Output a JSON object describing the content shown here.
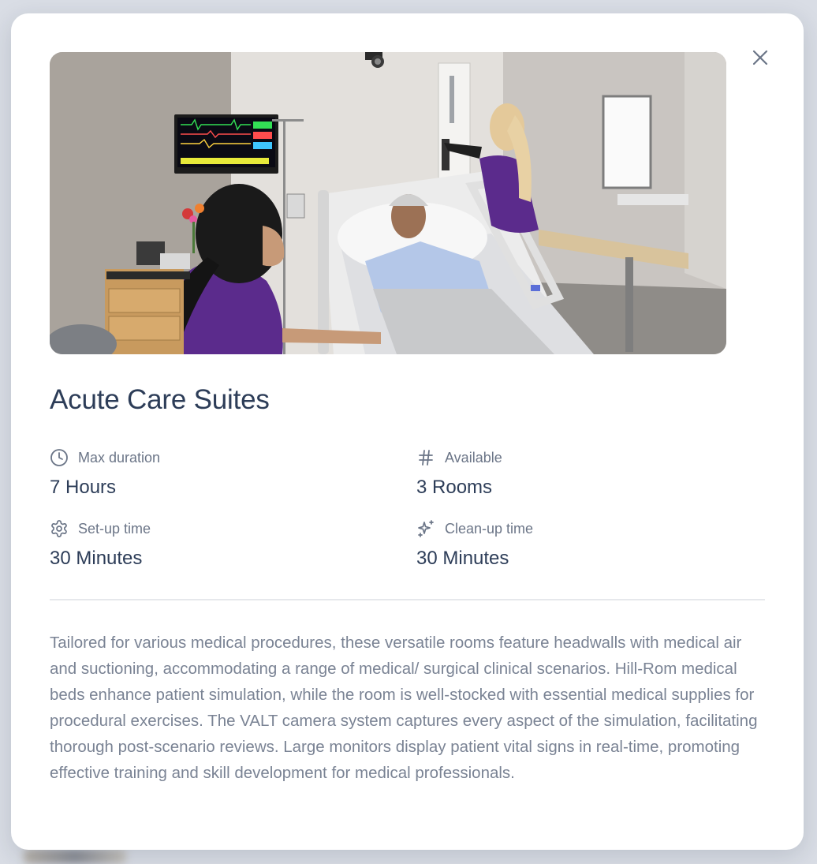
{
  "modal": {
    "close_icon": "close-icon",
    "title": "Acute Care Suites",
    "image_alt": "Acute care simulation suite with nursing students and patient manikin",
    "stats": {
      "max_duration": {
        "icon": "clock-icon",
        "label": "Max duration",
        "value": "7 Hours"
      },
      "available": {
        "icon": "hash-icon",
        "label": "Available",
        "value": "3 Rooms"
      },
      "setup_time": {
        "icon": "gear-icon",
        "label": "Set-up time",
        "value": "30 Minutes"
      },
      "cleanup_time": {
        "icon": "sparkles-icon",
        "label": "Clean-up time",
        "value": "30 Minutes"
      }
    },
    "description": "Tailored for various medical procedures, these versatile rooms feature headwalls with medical air and suctioning, accommodating a range of medical/ surgical clinical scenarios. Hill-Rom medical beds enhance patient simulation, while the room is well-stocked with essential medical supplies for procedural exercises. The VALT camera system captures every aspect of the simulation, facilitating thorough post-scenario reviews. Large monitors display patient vital signs in real-time, promoting effective training and skill development for medical professionals."
  },
  "colors": {
    "heading": "#2d3d58",
    "muted": "#6b7587",
    "body_text": "#7a8394",
    "scrubs_purple": "#5b2b8c"
  }
}
